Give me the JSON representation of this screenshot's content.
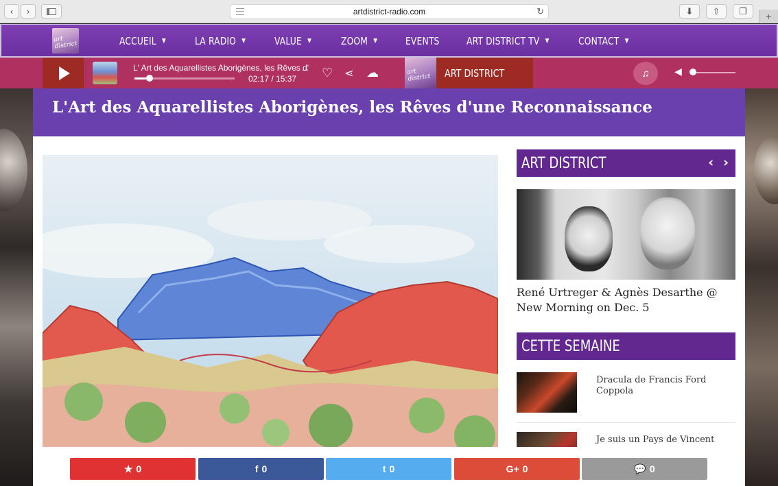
{
  "browser": {
    "url": "artdistrict-radio.com",
    "back_icon": "chevron-left-icon",
    "forward_icon": "chevron-right-icon",
    "new_tab_label": "+"
  },
  "nav": {
    "items": [
      {
        "label": "ACCUEIL",
        "has_caret": true
      },
      {
        "label": "LA RADIO",
        "has_caret": true
      },
      {
        "label": "VALUE",
        "has_caret": true
      },
      {
        "label": "ZOOM",
        "has_caret": true
      },
      {
        "label": "EVENTS",
        "has_caret": false
      },
      {
        "label": "ART DISTRICT TV",
        "has_caret": true
      },
      {
        "label": "CONTACT",
        "has_caret": true
      }
    ],
    "logo_text": "art district"
  },
  "player": {
    "track_title": "L' Art des Aquarellistes Aborigènes, les Rêves d' une Rec",
    "more_indicator": "...",
    "time": "02:17 / 15:37",
    "progress": 0.15,
    "station_name": "ART DISTRICT",
    "station_logo_text": "art district",
    "volume": 0.05,
    "colors": {
      "bar": "#b03060",
      "accent": "#9d2b24"
    }
  },
  "article": {
    "title": "L'Art des Aquarellistes Aborigènes, les Rêves d'une Reconnaissance"
  },
  "sidebar": {
    "art_district_heading": "ART DISTRICT",
    "feature_caption": "René Urtreger & Agnès Desarthe @ New Morning on Dec. 5",
    "week_heading": "CETTE SEMAINE",
    "week_items": [
      {
        "title": "Dracula de Francis Ford Coppola"
      },
      {
        "title": "Je suis un Pays de Vincent"
      }
    ]
  },
  "share": {
    "buttons": [
      {
        "name": "favorite",
        "icon": "★",
        "count": "0",
        "color": "#e03232"
      },
      {
        "name": "facebook",
        "icon": "f",
        "count": "0",
        "color": "#3b5998"
      },
      {
        "name": "twitter",
        "icon": "t",
        "count": "0",
        "color": "#55acee"
      },
      {
        "name": "google-plus",
        "icon": "G+",
        "count": "0",
        "color": "#dd4b39"
      },
      {
        "name": "comments",
        "icon": "💬",
        "count": "0",
        "color": "#9a9a9a"
      }
    ]
  }
}
